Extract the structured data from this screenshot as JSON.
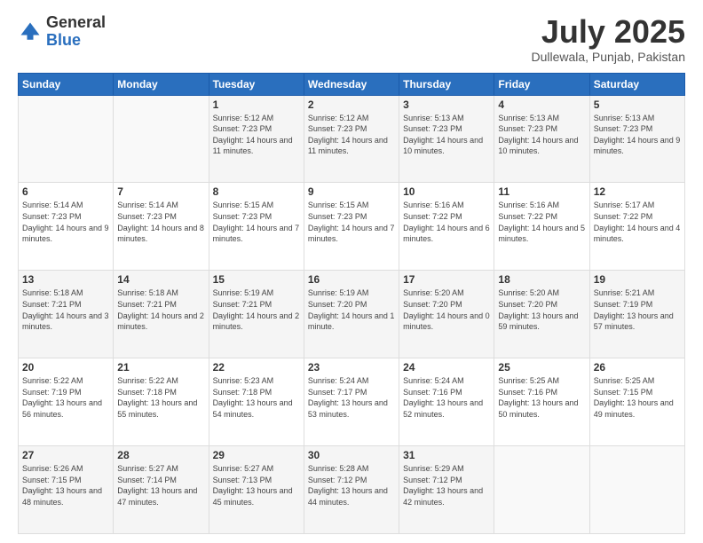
{
  "logo": {
    "general": "General",
    "blue": "Blue"
  },
  "header": {
    "month": "July 2025",
    "location": "Dullewala, Punjab, Pakistan"
  },
  "days_of_week": [
    "Sunday",
    "Monday",
    "Tuesday",
    "Wednesday",
    "Thursday",
    "Friday",
    "Saturday"
  ],
  "weeks": [
    [
      {
        "day": "",
        "sunrise": "",
        "sunset": "",
        "daylight": ""
      },
      {
        "day": "",
        "sunrise": "",
        "sunset": "",
        "daylight": ""
      },
      {
        "day": "1",
        "sunrise": "Sunrise: 5:12 AM",
        "sunset": "Sunset: 7:23 PM",
        "daylight": "Daylight: 14 hours and 11 minutes."
      },
      {
        "day": "2",
        "sunrise": "Sunrise: 5:12 AM",
        "sunset": "Sunset: 7:23 PM",
        "daylight": "Daylight: 14 hours and 11 minutes."
      },
      {
        "day": "3",
        "sunrise": "Sunrise: 5:13 AM",
        "sunset": "Sunset: 7:23 PM",
        "daylight": "Daylight: 14 hours and 10 minutes."
      },
      {
        "day": "4",
        "sunrise": "Sunrise: 5:13 AM",
        "sunset": "Sunset: 7:23 PM",
        "daylight": "Daylight: 14 hours and 10 minutes."
      },
      {
        "day": "5",
        "sunrise": "Sunrise: 5:13 AM",
        "sunset": "Sunset: 7:23 PM",
        "daylight": "Daylight: 14 hours and 9 minutes."
      }
    ],
    [
      {
        "day": "6",
        "sunrise": "Sunrise: 5:14 AM",
        "sunset": "Sunset: 7:23 PM",
        "daylight": "Daylight: 14 hours and 9 minutes."
      },
      {
        "day": "7",
        "sunrise": "Sunrise: 5:14 AM",
        "sunset": "Sunset: 7:23 PM",
        "daylight": "Daylight: 14 hours and 8 minutes."
      },
      {
        "day": "8",
        "sunrise": "Sunrise: 5:15 AM",
        "sunset": "Sunset: 7:23 PM",
        "daylight": "Daylight: 14 hours and 7 minutes."
      },
      {
        "day": "9",
        "sunrise": "Sunrise: 5:15 AM",
        "sunset": "Sunset: 7:23 PM",
        "daylight": "Daylight: 14 hours and 7 minutes."
      },
      {
        "day": "10",
        "sunrise": "Sunrise: 5:16 AM",
        "sunset": "Sunset: 7:22 PM",
        "daylight": "Daylight: 14 hours and 6 minutes."
      },
      {
        "day": "11",
        "sunrise": "Sunrise: 5:16 AM",
        "sunset": "Sunset: 7:22 PM",
        "daylight": "Daylight: 14 hours and 5 minutes."
      },
      {
        "day": "12",
        "sunrise": "Sunrise: 5:17 AM",
        "sunset": "Sunset: 7:22 PM",
        "daylight": "Daylight: 14 hours and 4 minutes."
      }
    ],
    [
      {
        "day": "13",
        "sunrise": "Sunrise: 5:18 AM",
        "sunset": "Sunset: 7:21 PM",
        "daylight": "Daylight: 14 hours and 3 minutes."
      },
      {
        "day": "14",
        "sunrise": "Sunrise: 5:18 AM",
        "sunset": "Sunset: 7:21 PM",
        "daylight": "Daylight: 14 hours and 2 minutes."
      },
      {
        "day": "15",
        "sunrise": "Sunrise: 5:19 AM",
        "sunset": "Sunset: 7:21 PM",
        "daylight": "Daylight: 14 hours and 2 minutes."
      },
      {
        "day": "16",
        "sunrise": "Sunrise: 5:19 AM",
        "sunset": "Sunset: 7:20 PM",
        "daylight": "Daylight: 14 hours and 1 minute."
      },
      {
        "day": "17",
        "sunrise": "Sunrise: 5:20 AM",
        "sunset": "Sunset: 7:20 PM",
        "daylight": "Daylight: 14 hours and 0 minutes."
      },
      {
        "day": "18",
        "sunrise": "Sunrise: 5:20 AM",
        "sunset": "Sunset: 7:20 PM",
        "daylight": "Daylight: 13 hours and 59 minutes."
      },
      {
        "day": "19",
        "sunrise": "Sunrise: 5:21 AM",
        "sunset": "Sunset: 7:19 PM",
        "daylight": "Daylight: 13 hours and 57 minutes."
      }
    ],
    [
      {
        "day": "20",
        "sunrise": "Sunrise: 5:22 AM",
        "sunset": "Sunset: 7:19 PM",
        "daylight": "Daylight: 13 hours and 56 minutes."
      },
      {
        "day": "21",
        "sunrise": "Sunrise: 5:22 AM",
        "sunset": "Sunset: 7:18 PM",
        "daylight": "Daylight: 13 hours and 55 minutes."
      },
      {
        "day": "22",
        "sunrise": "Sunrise: 5:23 AM",
        "sunset": "Sunset: 7:18 PM",
        "daylight": "Daylight: 13 hours and 54 minutes."
      },
      {
        "day": "23",
        "sunrise": "Sunrise: 5:24 AM",
        "sunset": "Sunset: 7:17 PM",
        "daylight": "Daylight: 13 hours and 53 minutes."
      },
      {
        "day": "24",
        "sunrise": "Sunrise: 5:24 AM",
        "sunset": "Sunset: 7:16 PM",
        "daylight": "Daylight: 13 hours and 52 minutes."
      },
      {
        "day": "25",
        "sunrise": "Sunrise: 5:25 AM",
        "sunset": "Sunset: 7:16 PM",
        "daylight": "Daylight: 13 hours and 50 minutes."
      },
      {
        "day": "26",
        "sunrise": "Sunrise: 5:25 AM",
        "sunset": "Sunset: 7:15 PM",
        "daylight": "Daylight: 13 hours and 49 minutes."
      }
    ],
    [
      {
        "day": "27",
        "sunrise": "Sunrise: 5:26 AM",
        "sunset": "Sunset: 7:15 PM",
        "daylight": "Daylight: 13 hours and 48 minutes."
      },
      {
        "day": "28",
        "sunrise": "Sunrise: 5:27 AM",
        "sunset": "Sunset: 7:14 PM",
        "daylight": "Daylight: 13 hours and 47 minutes."
      },
      {
        "day": "29",
        "sunrise": "Sunrise: 5:27 AM",
        "sunset": "Sunset: 7:13 PM",
        "daylight": "Daylight: 13 hours and 45 minutes."
      },
      {
        "day": "30",
        "sunrise": "Sunrise: 5:28 AM",
        "sunset": "Sunset: 7:12 PM",
        "daylight": "Daylight: 13 hours and 44 minutes."
      },
      {
        "day": "31",
        "sunrise": "Sunrise: 5:29 AM",
        "sunset": "Sunset: 7:12 PM",
        "daylight": "Daylight: 13 hours and 42 minutes."
      },
      {
        "day": "",
        "sunrise": "",
        "sunset": "",
        "daylight": ""
      },
      {
        "day": "",
        "sunrise": "",
        "sunset": "",
        "daylight": ""
      }
    ]
  ]
}
